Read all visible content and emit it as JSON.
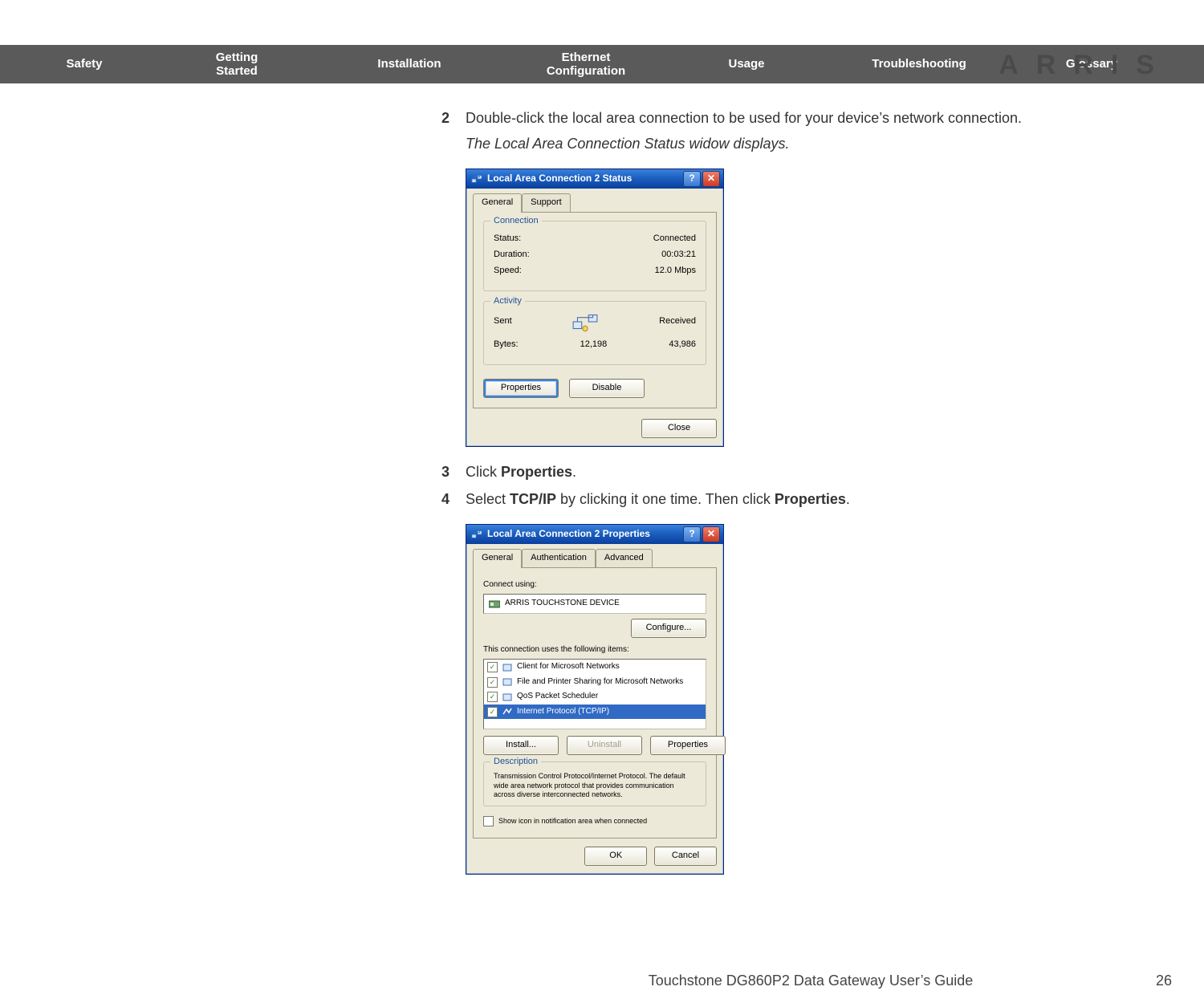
{
  "brand": "ARRIS",
  "nav": {
    "safety": "Safety",
    "getting_l1": "Getting",
    "getting_l2": "Started",
    "installation": "Installation",
    "ethernet_l1": "Ethernet",
    "ethernet_l2": "Configuration",
    "usage": "Usage",
    "troubleshooting": "Troubleshooting",
    "glossary": "Glossary"
  },
  "steps": {
    "s2_num": "2",
    "s2_text": "Double-click the local area connection to be used for your device’s network connection.",
    "s2_note": "The Local Area Connection Status widow displays.",
    "s3_num": "3",
    "s3_pre": "Click ",
    "s3_bold": "Properties",
    "s3_post": ".",
    "s4_num": "4",
    "s4_pre": "Select ",
    "s4_b1": "TCP/IP",
    "s4_mid": " by clicking it one time. Then click ",
    "s4_b2": "Properties",
    "s4_post": "."
  },
  "dlg1": {
    "title": "Local Area Connection 2 Status",
    "tab_general": "General",
    "tab_support": "Support",
    "grp_connection": "Connection",
    "status_lbl": "Status:",
    "status_val": "Connected",
    "duration_lbl": "Duration:",
    "duration_val": "00:03:21",
    "speed_lbl": "Speed:",
    "speed_val": "12.0 Mbps",
    "grp_activity": "Activity",
    "sent": "Sent",
    "received": "Received",
    "bytes_lbl": "Bytes:",
    "bytes_sent": "12,198",
    "bytes_recv": "43,986",
    "btn_properties": "Properties",
    "btn_disable": "Disable",
    "btn_close": "Close"
  },
  "dlg2": {
    "title": "Local Area Connection 2 Properties",
    "tab_general": "General",
    "tab_auth": "Authentication",
    "tab_adv": "Advanced",
    "connect_using": "Connect using:",
    "device": "ARRIS TOUCHSTONE DEVICE",
    "btn_configure": "Configure...",
    "uses_label": "This connection uses the following items:",
    "item1": "Client for Microsoft Networks",
    "item2": "File and Printer Sharing for Microsoft Networks",
    "item3": "QoS Packet Scheduler",
    "item4": "Internet Protocol (TCP/IP)",
    "btn_install": "Install...",
    "btn_uninstall": "Uninstall",
    "btn_props": "Properties",
    "desc_title": "Description",
    "desc_text": "Transmission Control Protocol/Internet Protocol. The default wide area network protocol that provides communication across diverse interconnected networks.",
    "show_icon": "Show icon in notification area when connected",
    "btn_ok": "OK",
    "btn_cancel": "Cancel"
  },
  "footer": {
    "title": "Touchstone DG860P2 Data Gateway User’s Guide",
    "page": "26"
  }
}
